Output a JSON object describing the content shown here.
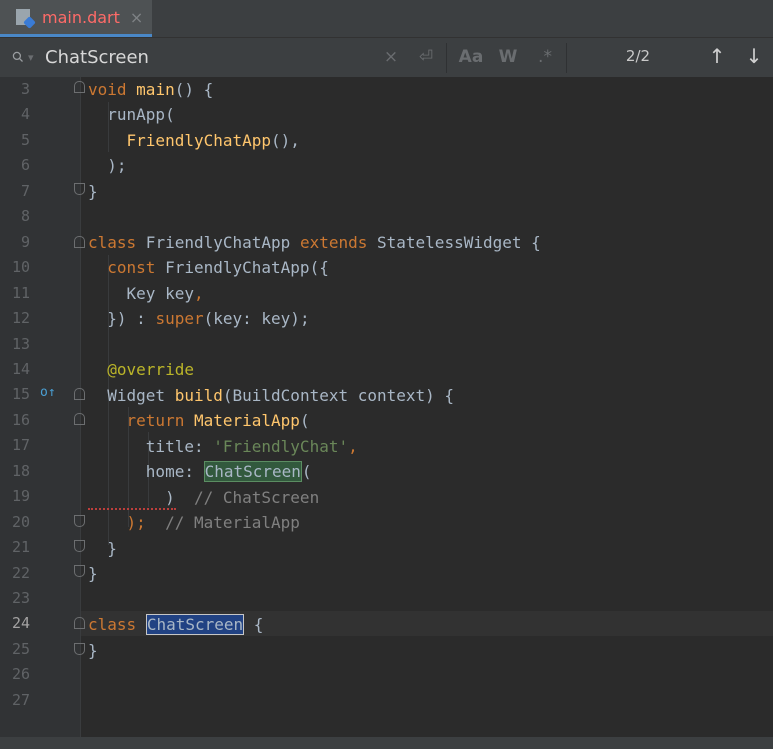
{
  "tab": {
    "label": "main.dart",
    "close": "×"
  },
  "search": {
    "value": "ChatScreen",
    "match_count": "2/2",
    "clear": "×",
    "newline_btn": "⏎",
    "case_btn": "Aa",
    "word_btn": "W",
    "regex_btn": ".*",
    "prev": "↑",
    "next": "↓"
  },
  "gutter": {
    "line_numbers": [
      "3",
      "4",
      "5",
      "6",
      "7",
      "8",
      "9",
      "10",
      "11",
      "12",
      "13",
      "14",
      "15",
      "16",
      "17",
      "18",
      "19",
      "20",
      "21",
      "22",
      "23",
      "24",
      "25",
      "26",
      "27"
    ],
    "override_marker": "o↑"
  },
  "code": {
    "l3": [
      "void",
      " ",
      "main",
      "() {"
    ],
    "l4": "  runApp(",
    "l5": [
      "    ",
      "FriendlyChatApp",
      "(),"
    ],
    "l6": "  );",
    "l7": "}",
    "l9": [
      "class",
      " FriendlyChatApp ",
      "extends",
      " StatelessWidget {"
    ],
    "l10": [
      "  ",
      "const",
      " FriendlyChatApp({"
    ],
    "l11": [
      "    Key key",
      ","
    ],
    "l12": [
      "  }) : ",
      "super",
      "(key: key);"
    ],
    "l14": [
      "  ",
      "@override"
    ],
    "l15": [
      "  Widget ",
      "build",
      "(BuildContext context) {"
    ],
    "l16": [
      "    ",
      "return",
      " ",
      "MaterialApp",
      "("
    ],
    "l17": [
      "      title: ",
      "'FriendlyChat'",
      ","
    ],
    "l18": [
      "      home: ",
      "ChatScreen",
      "("
    ],
    "l19": [
      "        )  ",
      "// ChatScreen"
    ],
    "l20": [
      "    );  ",
      "// MaterialApp"
    ],
    "l21": "  }",
    "l22": "}",
    "l24": [
      "class",
      " ",
      "ChatScreen",
      " {"
    ],
    "l25": "}"
  }
}
